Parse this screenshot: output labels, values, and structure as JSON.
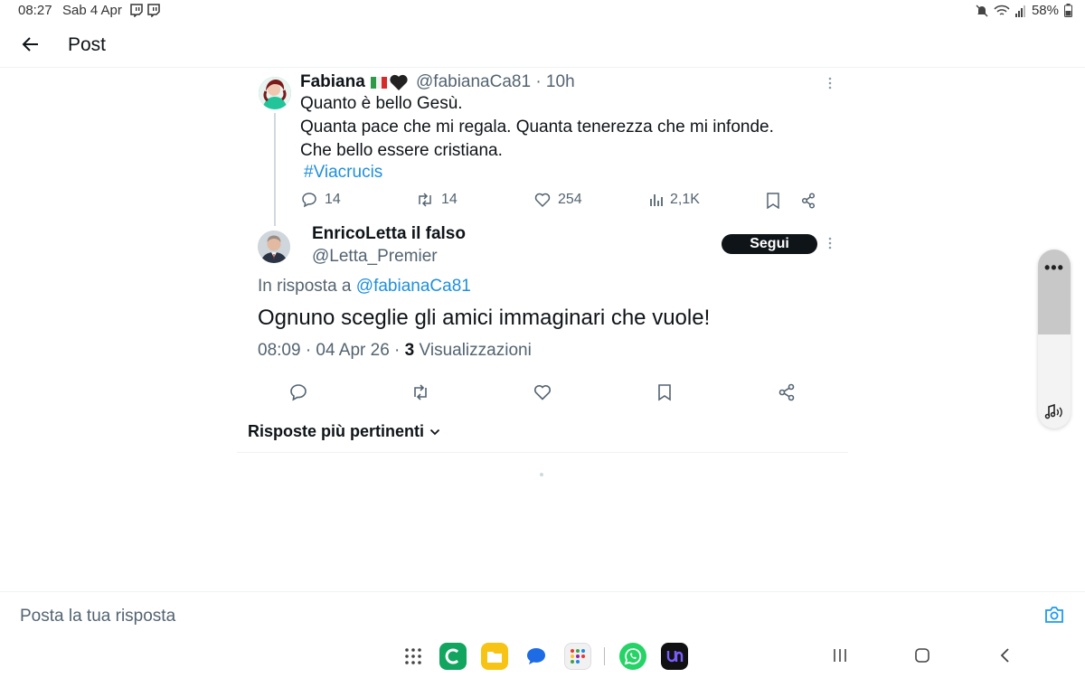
{
  "status_bar": {
    "time": "08:27",
    "date": "Sab 4 Apr",
    "battery": "58%"
  },
  "header": {
    "title": "Post"
  },
  "parent_tweet": {
    "name": "Fabiana",
    "handle_time": "@fabianaCa81 · 10h",
    "lines": [
      "Quanto è bello Gesù.",
      "Quanta pace che mi regala. Quanta tenerezza che mi infonde.",
      "Che bello essere cristiana."
    ],
    "hashtag": "#Viacrucis",
    "replies": "14",
    "reposts": "14",
    "likes": "254",
    "views": "2,1K"
  },
  "main_tweet": {
    "name": "EnricoLetta il falso",
    "handle": "@Letta_Premier",
    "follow_label": "Segui",
    "reply_prefix": "In risposta a",
    "reply_mention": "@fabianaCa81",
    "text": "Ognuno sceglie gli amici immaginari che vuole!",
    "timestamp": "08:09 · 04 Apr 26 ·",
    "views_count": "3",
    "views_label": "Visualizzazioni"
  },
  "replies_sort": {
    "label": "Risposte più pertinenti"
  },
  "reply_bar": {
    "placeholder": "Posta la tua risposta"
  },
  "colors": {
    "accent": "#1d9bf0",
    "text_primary": "#0f1419",
    "text_secondary": "#536471"
  }
}
